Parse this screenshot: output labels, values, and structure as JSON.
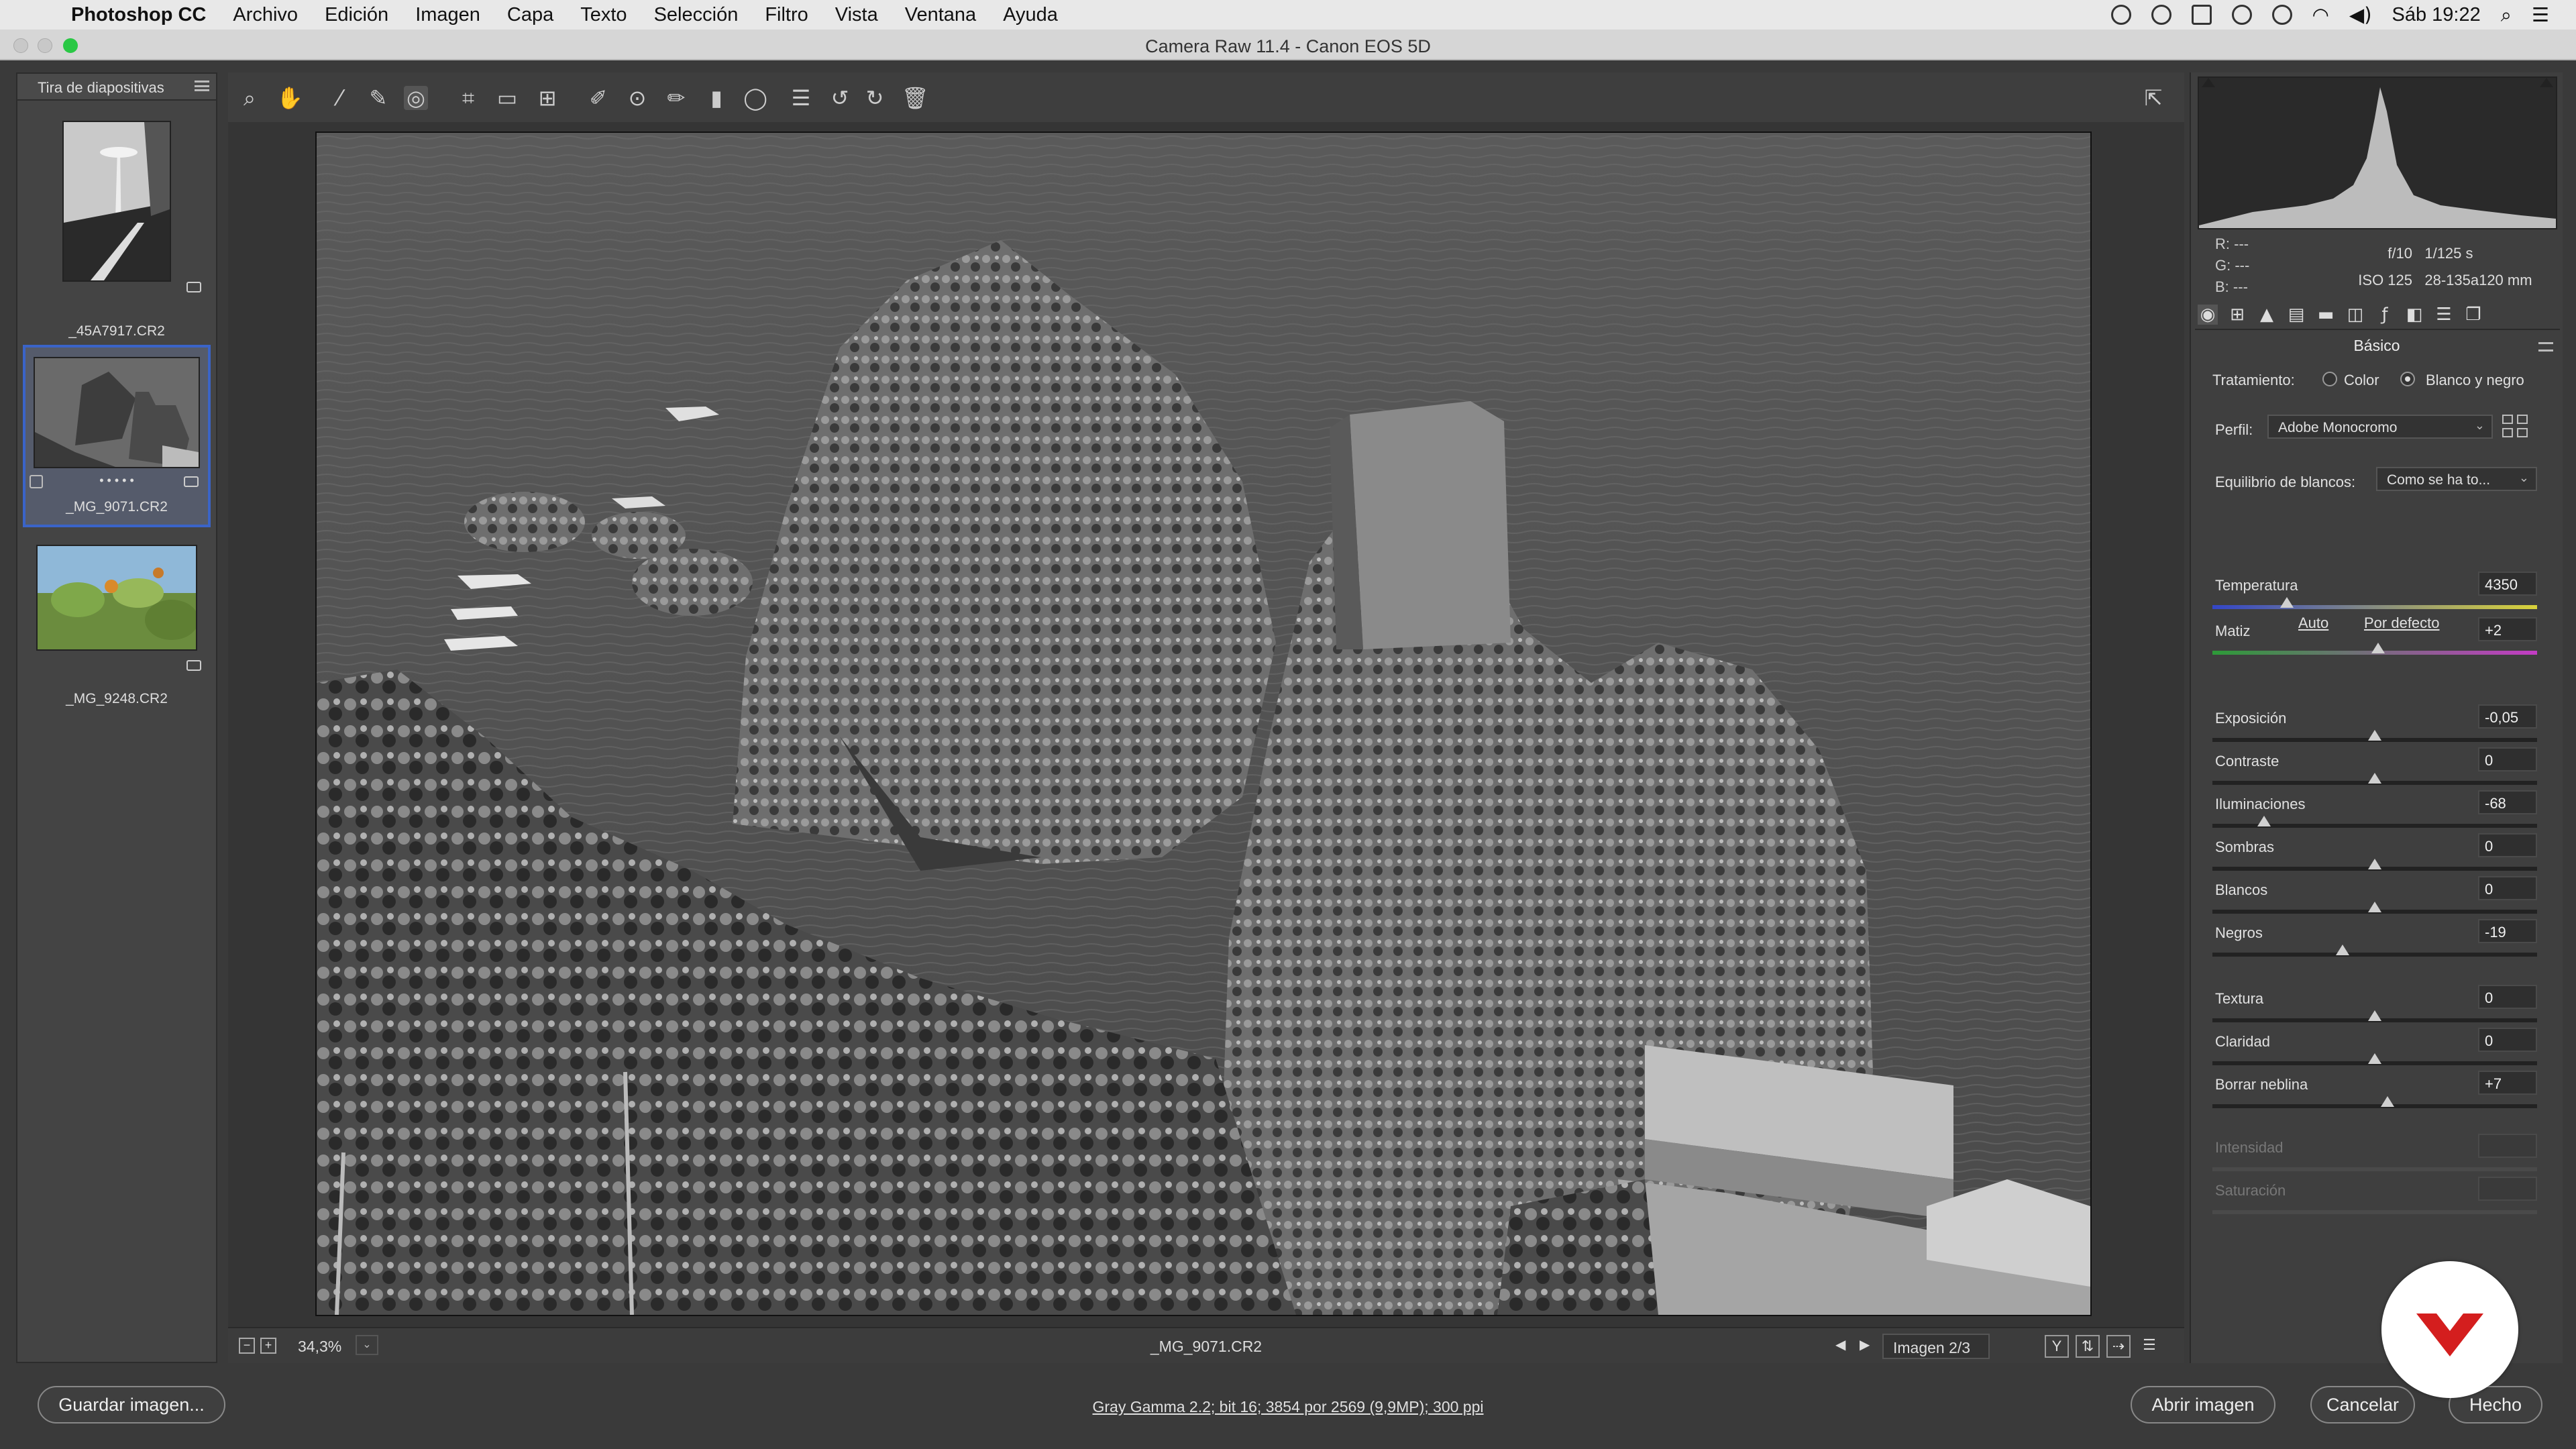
{
  "menubar": {
    "app": "Photoshop CC",
    "items": [
      "Archivo",
      "Edición",
      "Imagen",
      "Capa",
      "Texto",
      "Selección",
      "Filtro",
      "Vista",
      "Ventana",
      "Ayuda"
    ],
    "clock": "Sáb 19:22"
  },
  "window": {
    "title": "Camera Raw 11.4 -  Canon EOS 5D"
  },
  "filmstrip": {
    "title": "Tira de diapositivas",
    "items": [
      {
        "name": "_45A7917.CR2"
      },
      {
        "name": "_MG_9071.CR2",
        "rating_dots": "• • • • •"
      },
      {
        "name": "_MG_9248.CR2"
      }
    ]
  },
  "toolbar": {
    "tools": [
      "zoom-tool",
      "hand-tool",
      "white-balance-tool",
      "color-sampler-tool",
      "targeted-adjustment-tool",
      "crop-tool",
      "straighten-tool",
      "transform-tool",
      "spot-removal-tool",
      "red-eye-tool",
      "adjustment-brush-tool",
      "graduated-filter-tool",
      "radial-filter-tool",
      "presets-list",
      "rotate-left",
      "rotate-right",
      "trash"
    ]
  },
  "canvas": {
    "zoom": "34,3%",
    "filename": "_MG_9071.CR2",
    "image_counter": "Imagen 2/3",
    "view_y_label": "Y"
  },
  "histogram": {
    "r_label": "R:",
    "r_val": "---",
    "g_label": "G:",
    "g_val": "---",
    "b_label": "B:",
    "b_val": "---",
    "aperture": "f/10",
    "shutter": "1/125 s",
    "iso": "ISO 125",
    "lens": "28-135a120 mm"
  },
  "basic": {
    "section_title": "Básico",
    "treatment_label": "Tratamiento:",
    "treatment_color": "Color",
    "treatment_bw": "Blanco y negro",
    "treatment_selected": "Blanco y negro",
    "profile_label": "Perfil:",
    "profile_value": "Adobe Monocromo",
    "wb_label": "Equilibrio de blancos:",
    "wb_value": "Como se ha to...",
    "auto": "Auto",
    "default": "Por defecto",
    "sliders": [
      {
        "label": "Temperatura",
        "value": "4350",
        "level": 0.23
      },
      {
        "label": "Matiz",
        "value": "+2",
        "level": 0.51
      },
      {
        "label": "Exposición",
        "value": "-0,05",
        "level": 0.5
      },
      {
        "label": "Contraste",
        "value": "0",
        "level": 0.5
      },
      {
        "label": "Iluminaciones",
        "value": "-68",
        "level": 0.16
      },
      {
        "label": "Sombras",
        "value": "0",
        "level": 0.5
      },
      {
        "label": "Blancos",
        "value": "0",
        "level": 0.5
      },
      {
        "label": "Negros",
        "value": "-19",
        "level": 0.4
      },
      {
        "label": "Textura",
        "value": "0",
        "level": 0.5
      },
      {
        "label": "Claridad",
        "value": "0",
        "level": 0.5
      },
      {
        "label": "Borrar neblina",
        "value": "+7",
        "level": 0.54
      },
      {
        "label": "Intensidad",
        "value": "",
        "level": null
      },
      {
        "label": "Saturación",
        "value": "",
        "level": null
      }
    ]
  },
  "footer": {
    "save": "Guardar imagen...",
    "workflow": "Gray Gamma 2.2; bit 16; 3854 por 2569 (9,9MP); 300 ppi",
    "open": "Abrir imagen",
    "cancel": "Cancelar",
    "done": "Hecho"
  },
  "colors": {
    "accent": "#3a64c8",
    "badge": "#d41e1e",
    "macos_green": "#2ac845"
  }
}
